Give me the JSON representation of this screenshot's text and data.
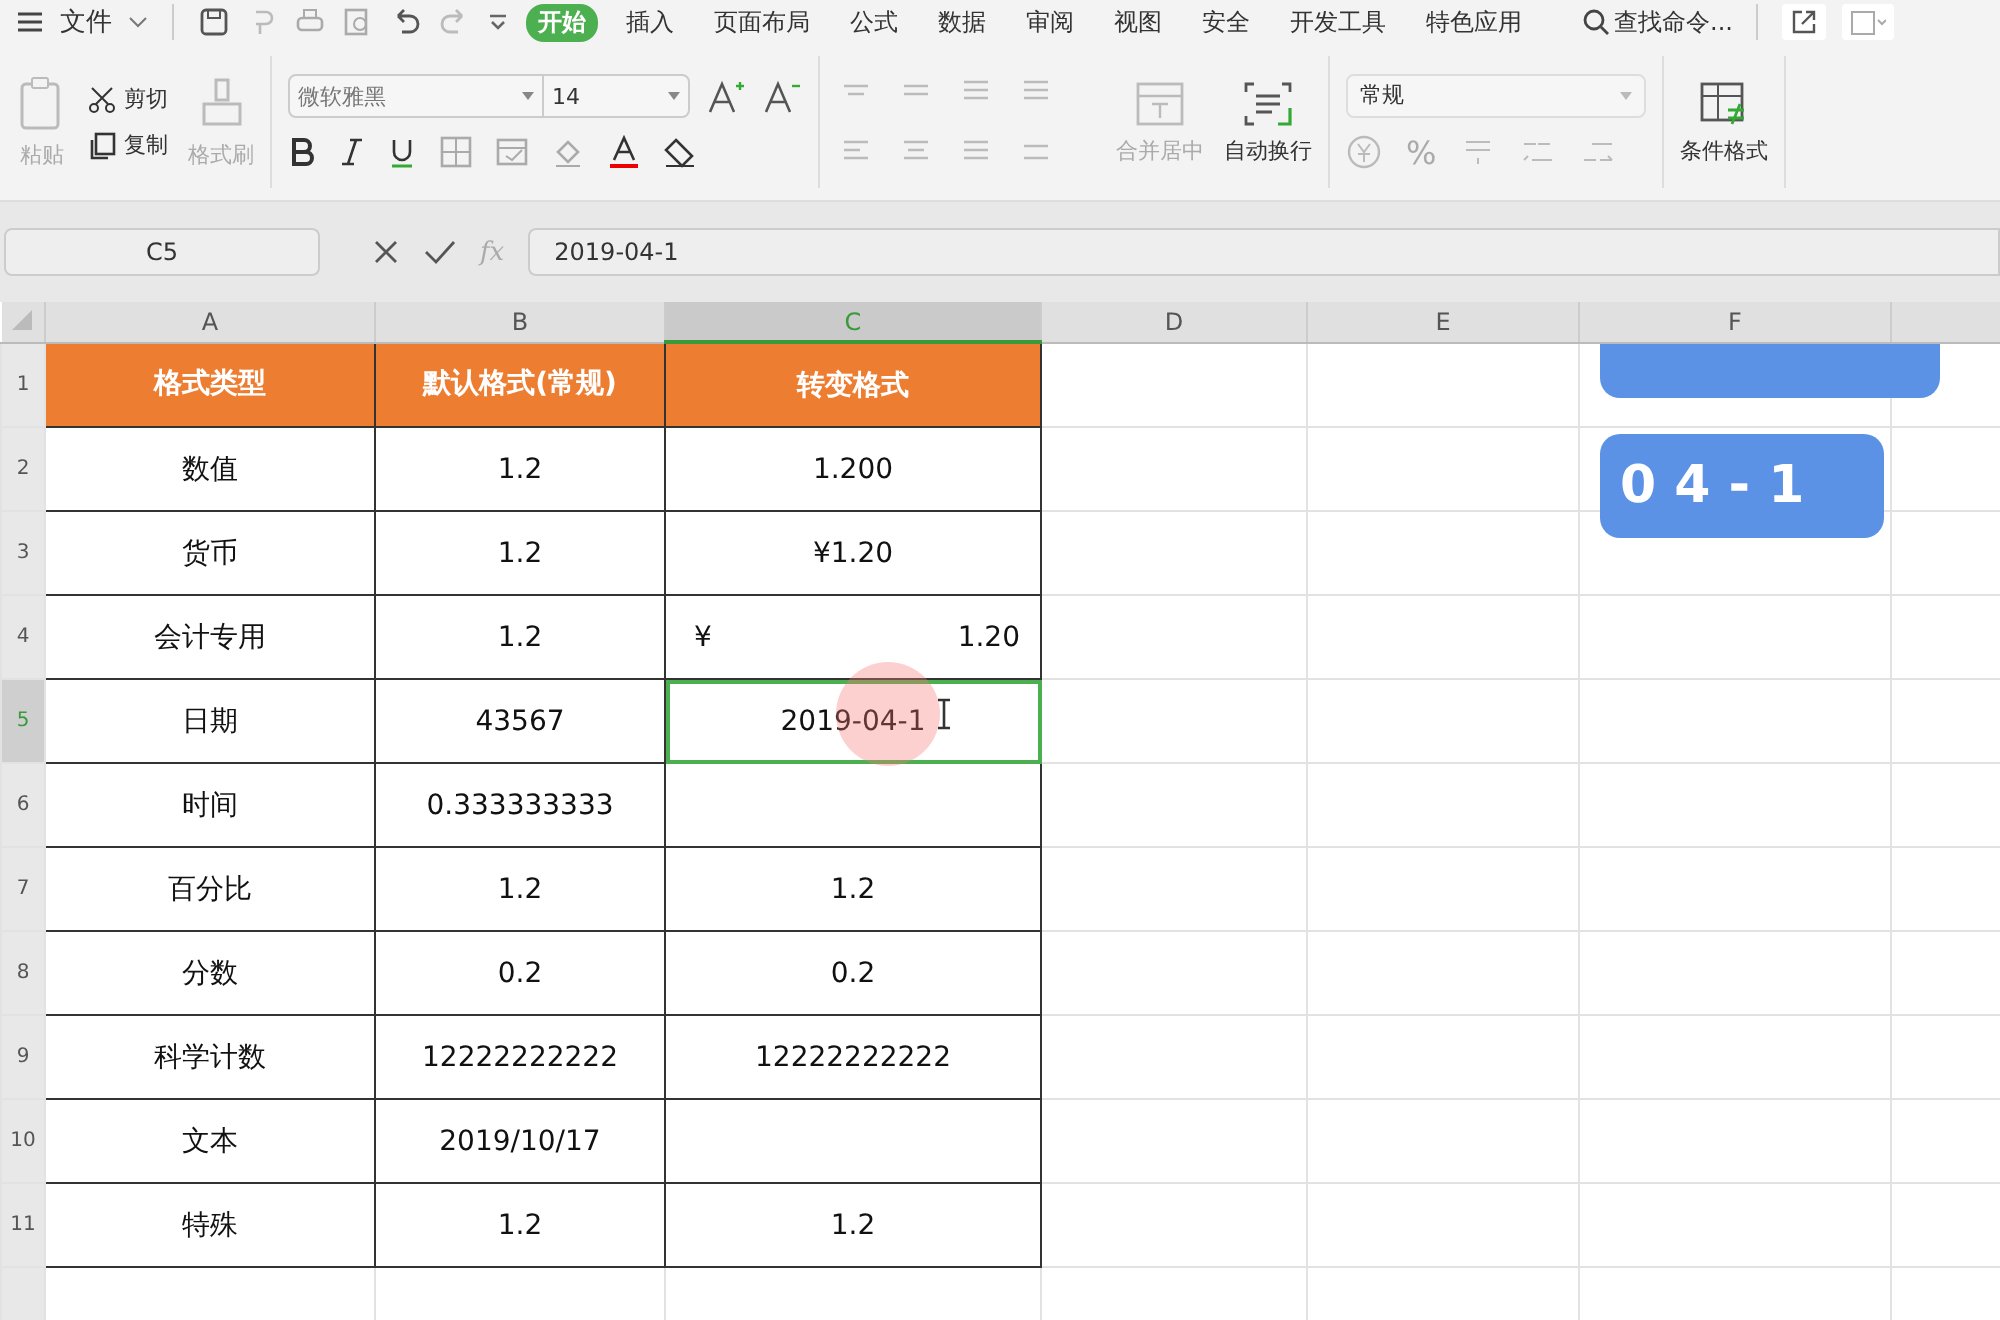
{
  "menu_bar": {
    "file_label": "文件",
    "tabs": [
      {
        "label": "开始",
        "selected": true
      },
      {
        "label": "插入",
        "selected": false
      },
      {
        "label": "页面布局",
        "selected": false
      },
      {
        "label": "公式",
        "selected": false
      },
      {
        "label": "数据",
        "selected": false
      },
      {
        "label": "审阅",
        "selected": false
      },
      {
        "label": "视图",
        "selected": false
      },
      {
        "label": "安全",
        "selected": false
      },
      {
        "label": "开发工具",
        "selected": false
      },
      {
        "label": "特色应用",
        "selected": false
      }
    ],
    "search": "查找命令..."
  },
  "ribbon": {
    "paste": "粘贴",
    "cut": "剪切",
    "copy": "复制",
    "format_painter": "格式刷",
    "font_name": "微软雅黑",
    "font_size": "14",
    "merge_center": "合并居中",
    "wrap_text": "自动换行",
    "number_format": "常规",
    "percent": "%",
    "conditional_format": "条件格式"
  },
  "formula_bar": {
    "name_box": "C5",
    "function_label": "fx",
    "value": "2019-04-1"
  },
  "columns": [
    {
      "label": "A",
      "selected": false
    },
    {
      "label": "B",
      "selected": false
    },
    {
      "label": "C",
      "selected": true
    },
    {
      "label": "D",
      "selected": false
    },
    {
      "label": "E",
      "selected": false
    },
    {
      "label": "F",
      "selected": false
    }
  ],
  "rows": [
    {
      "number": "1",
      "selected": false,
      "header": true,
      "cells": [
        {
          "kind": "text",
          "text": "格式类型"
        },
        {
          "kind": "text",
          "text": "默认格式(常规)"
        },
        {
          "kind": "text",
          "text": "转变格式"
        }
      ]
    },
    {
      "number": "2",
      "selected": false,
      "header": false,
      "cells": [
        {
          "kind": "text",
          "text": "数值"
        },
        {
          "kind": "text",
          "text": "1.2"
        },
        {
          "kind": "text",
          "text": "1.200"
        }
      ]
    },
    {
      "number": "3",
      "selected": false,
      "header": false,
      "cells": [
        {
          "kind": "text",
          "text": "货币"
        },
        {
          "kind": "text",
          "text": "1.2"
        },
        {
          "kind": "text",
          "text": "¥1.20"
        }
      ]
    },
    {
      "number": "4",
      "selected": false,
      "header": false,
      "cells": [
        {
          "kind": "text",
          "text": "会计专用"
        },
        {
          "kind": "text",
          "text": "1.2"
        },
        {
          "kind": "accounting",
          "symbol": "¥",
          "amount": "1.20"
        }
      ]
    },
    {
      "number": "5",
      "selected": true,
      "header": false,
      "cells": [
        {
          "kind": "text",
          "text": "日期"
        },
        {
          "kind": "text",
          "text": "43567"
        },
        {
          "kind": "text",
          "text": "2019-04-1"
        }
      ]
    },
    {
      "number": "6",
      "selected": false,
      "header": false,
      "cells": [
        {
          "kind": "text",
          "text": "时间"
        },
        {
          "kind": "text",
          "text": "0.333333333"
        },
        {
          "kind": "text",
          "text": ""
        }
      ]
    },
    {
      "number": "7",
      "selected": false,
      "header": false,
      "cells": [
        {
          "kind": "text",
          "text": "百分比"
        },
        {
          "kind": "text",
          "text": "1.2"
        },
        {
          "kind": "text",
          "text": "1.2"
        }
      ]
    },
    {
      "number": "8",
      "selected": false,
      "header": false,
      "cells": [
        {
          "kind": "text",
          "text": "分数"
        },
        {
          "kind": "text",
          "text": "0.2"
        },
        {
          "kind": "text",
          "text": "0.2"
        }
      ]
    },
    {
      "number": "9",
      "selected": false,
      "header": false,
      "cells": [
        {
          "kind": "text",
          "text": "科学计数"
        },
        {
          "kind": "text",
          "text": "12222222222"
        },
        {
          "kind": "text",
          "text": "12222222222"
        }
      ]
    },
    {
      "number": "10",
      "selected": false,
      "header": false,
      "cells": [
        {
          "kind": "text",
          "text": "文本"
        },
        {
          "kind": "text",
          "text": "2019/10/17"
        },
        {
          "kind": "text",
          "text": ""
        }
      ]
    },
    {
      "number": "11",
      "selected": false,
      "header": false,
      "cells": [
        {
          "kind": "text",
          "text": "特殊"
        },
        {
          "kind": "text",
          "text": "1.2"
        },
        {
          "kind": "text",
          "text": "1.2"
        }
      ]
    }
  ],
  "overlay": {
    "caption": "0 4 - 1"
  }
}
